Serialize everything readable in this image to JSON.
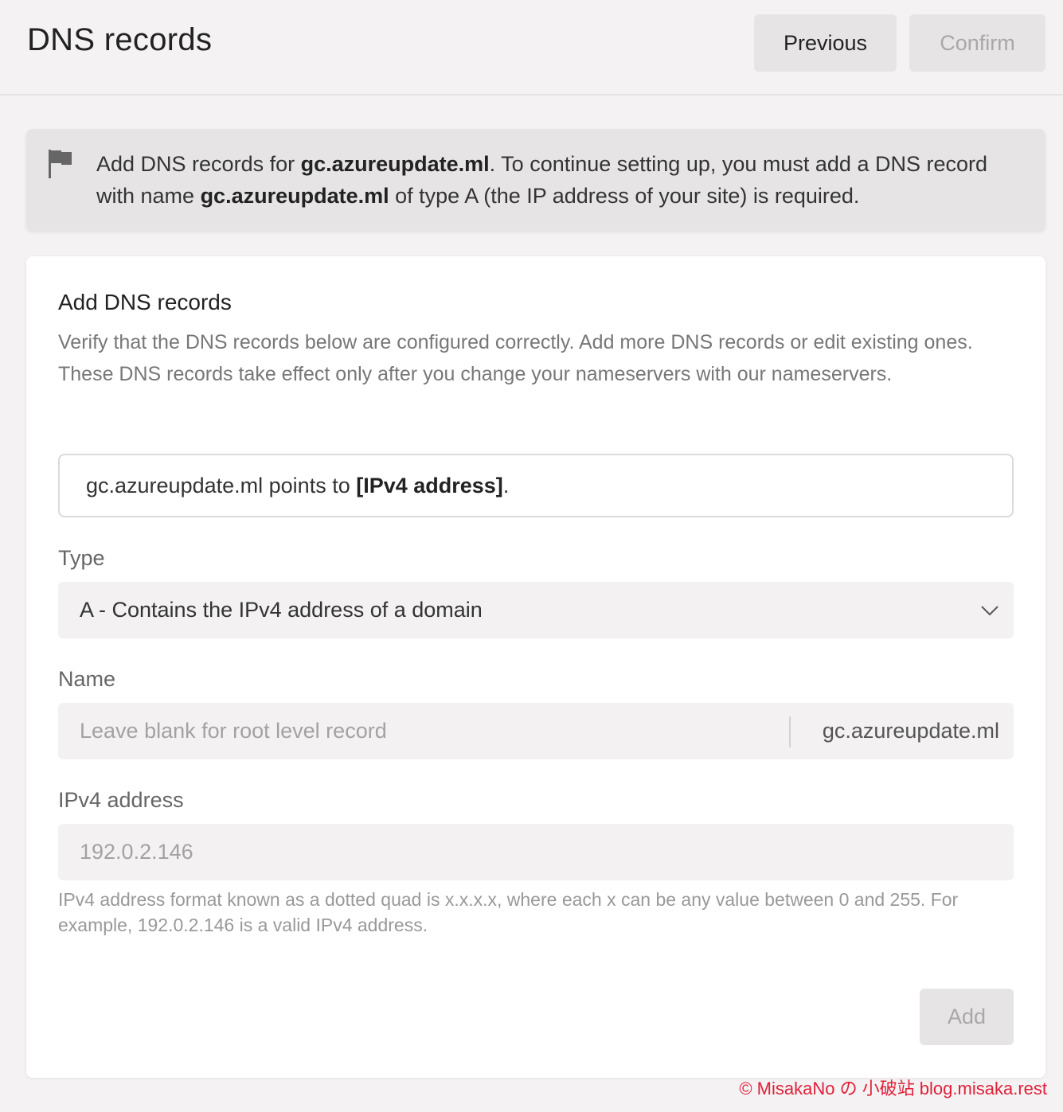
{
  "header": {
    "title": "DNS records",
    "previous_label": "Previous",
    "confirm_label": "Confirm"
  },
  "banner": {
    "icon": "flag-icon",
    "text_1": "Add DNS records for ",
    "domain_1": "gc.azureupdate.ml",
    "text_2": ". To continue setting up, you must add a DNS record with name ",
    "domain_2": "gc.azureupdate.ml",
    "text_3": " of type A (the IP address of your site) is required."
  },
  "card": {
    "title": "Add DNS records",
    "description": "Verify that the DNS records below are configured correctly. Add more DNS records or edit existing ones. These DNS records take effect only after you change your nameservers with our nameservers.",
    "preview": {
      "domain": "gc.azureupdate.ml",
      "middle": " points to ",
      "target": "[IPv4 address]",
      "end": "."
    },
    "type_label": "Type",
    "type_value": "A - Contains the IPv4 address of a domain",
    "name_label": "Name",
    "name_placeholder": "Leave blank for root level record",
    "name_suffix": "gc.azureupdate.ml",
    "ip_label": "IPv4 address",
    "ip_placeholder": "192.0.2.146",
    "ip_help": "IPv4 address format known as a dotted quad is x.x.x.x, where each x can be any value between 0 and 255. For example, 192.0.2.146 is a valid IPv4 address.",
    "add_label": "Add"
  },
  "watermark": "© MisakaNo の 小破站 blog.misaka.rest",
  "colors": {
    "background": "#f4f2f2",
    "button_bg": "#e6e4e4",
    "input_bg": "#f3f1f1",
    "disabled_text": "#a9a7a7",
    "watermark": "#e0203a"
  }
}
